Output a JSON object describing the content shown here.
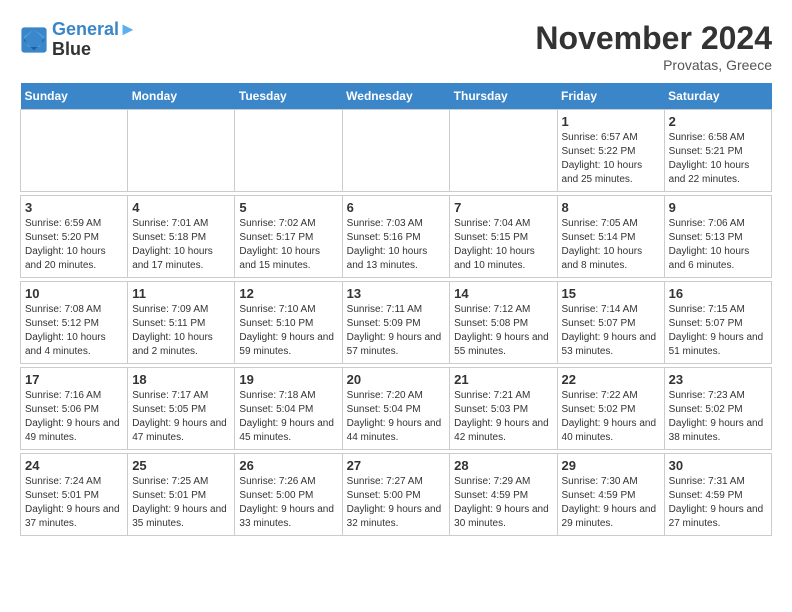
{
  "logo": {
    "line1": "General",
    "line2": "Blue"
  },
  "title": "November 2024",
  "location": "Provatas, Greece",
  "weekdays": [
    "Sunday",
    "Monday",
    "Tuesday",
    "Wednesday",
    "Thursday",
    "Friday",
    "Saturday"
  ],
  "weeks": [
    [
      {
        "day": "",
        "info": ""
      },
      {
        "day": "",
        "info": ""
      },
      {
        "day": "",
        "info": ""
      },
      {
        "day": "",
        "info": ""
      },
      {
        "day": "",
        "info": ""
      },
      {
        "day": "1",
        "info": "Sunrise: 6:57 AM\nSunset: 5:22 PM\nDaylight: 10 hours\nand 25 minutes."
      },
      {
        "day": "2",
        "info": "Sunrise: 6:58 AM\nSunset: 5:21 PM\nDaylight: 10 hours\nand 22 minutes."
      }
    ],
    [
      {
        "day": "3",
        "info": "Sunrise: 6:59 AM\nSunset: 5:20 PM\nDaylight: 10 hours\nand 20 minutes."
      },
      {
        "day": "4",
        "info": "Sunrise: 7:01 AM\nSunset: 5:18 PM\nDaylight: 10 hours\nand 17 minutes."
      },
      {
        "day": "5",
        "info": "Sunrise: 7:02 AM\nSunset: 5:17 PM\nDaylight: 10 hours\nand 15 minutes."
      },
      {
        "day": "6",
        "info": "Sunrise: 7:03 AM\nSunset: 5:16 PM\nDaylight: 10 hours\nand 13 minutes."
      },
      {
        "day": "7",
        "info": "Sunrise: 7:04 AM\nSunset: 5:15 PM\nDaylight: 10 hours\nand 10 minutes."
      },
      {
        "day": "8",
        "info": "Sunrise: 7:05 AM\nSunset: 5:14 PM\nDaylight: 10 hours\nand 8 minutes."
      },
      {
        "day": "9",
        "info": "Sunrise: 7:06 AM\nSunset: 5:13 PM\nDaylight: 10 hours\nand 6 minutes."
      }
    ],
    [
      {
        "day": "10",
        "info": "Sunrise: 7:08 AM\nSunset: 5:12 PM\nDaylight: 10 hours\nand 4 minutes."
      },
      {
        "day": "11",
        "info": "Sunrise: 7:09 AM\nSunset: 5:11 PM\nDaylight: 10 hours\nand 2 minutes."
      },
      {
        "day": "12",
        "info": "Sunrise: 7:10 AM\nSunset: 5:10 PM\nDaylight: 9 hours\nand 59 minutes."
      },
      {
        "day": "13",
        "info": "Sunrise: 7:11 AM\nSunset: 5:09 PM\nDaylight: 9 hours\nand 57 minutes."
      },
      {
        "day": "14",
        "info": "Sunrise: 7:12 AM\nSunset: 5:08 PM\nDaylight: 9 hours\nand 55 minutes."
      },
      {
        "day": "15",
        "info": "Sunrise: 7:14 AM\nSunset: 5:07 PM\nDaylight: 9 hours\nand 53 minutes."
      },
      {
        "day": "16",
        "info": "Sunrise: 7:15 AM\nSunset: 5:07 PM\nDaylight: 9 hours\nand 51 minutes."
      }
    ],
    [
      {
        "day": "17",
        "info": "Sunrise: 7:16 AM\nSunset: 5:06 PM\nDaylight: 9 hours\nand 49 minutes."
      },
      {
        "day": "18",
        "info": "Sunrise: 7:17 AM\nSunset: 5:05 PM\nDaylight: 9 hours\nand 47 minutes."
      },
      {
        "day": "19",
        "info": "Sunrise: 7:18 AM\nSunset: 5:04 PM\nDaylight: 9 hours\nand 45 minutes."
      },
      {
        "day": "20",
        "info": "Sunrise: 7:20 AM\nSunset: 5:04 PM\nDaylight: 9 hours\nand 44 minutes."
      },
      {
        "day": "21",
        "info": "Sunrise: 7:21 AM\nSunset: 5:03 PM\nDaylight: 9 hours\nand 42 minutes."
      },
      {
        "day": "22",
        "info": "Sunrise: 7:22 AM\nSunset: 5:02 PM\nDaylight: 9 hours\nand 40 minutes."
      },
      {
        "day": "23",
        "info": "Sunrise: 7:23 AM\nSunset: 5:02 PM\nDaylight: 9 hours\nand 38 minutes."
      }
    ],
    [
      {
        "day": "24",
        "info": "Sunrise: 7:24 AM\nSunset: 5:01 PM\nDaylight: 9 hours\nand 37 minutes."
      },
      {
        "day": "25",
        "info": "Sunrise: 7:25 AM\nSunset: 5:01 PM\nDaylight: 9 hours\nand 35 minutes."
      },
      {
        "day": "26",
        "info": "Sunrise: 7:26 AM\nSunset: 5:00 PM\nDaylight: 9 hours\nand 33 minutes."
      },
      {
        "day": "27",
        "info": "Sunrise: 7:27 AM\nSunset: 5:00 PM\nDaylight: 9 hours\nand 32 minutes."
      },
      {
        "day": "28",
        "info": "Sunrise: 7:29 AM\nSunset: 4:59 PM\nDaylight: 9 hours\nand 30 minutes."
      },
      {
        "day": "29",
        "info": "Sunrise: 7:30 AM\nSunset: 4:59 PM\nDaylight: 9 hours\nand 29 minutes."
      },
      {
        "day": "30",
        "info": "Sunrise: 7:31 AM\nSunset: 4:59 PM\nDaylight: 9 hours\nand 27 minutes."
      }
    ]
  ]
}
